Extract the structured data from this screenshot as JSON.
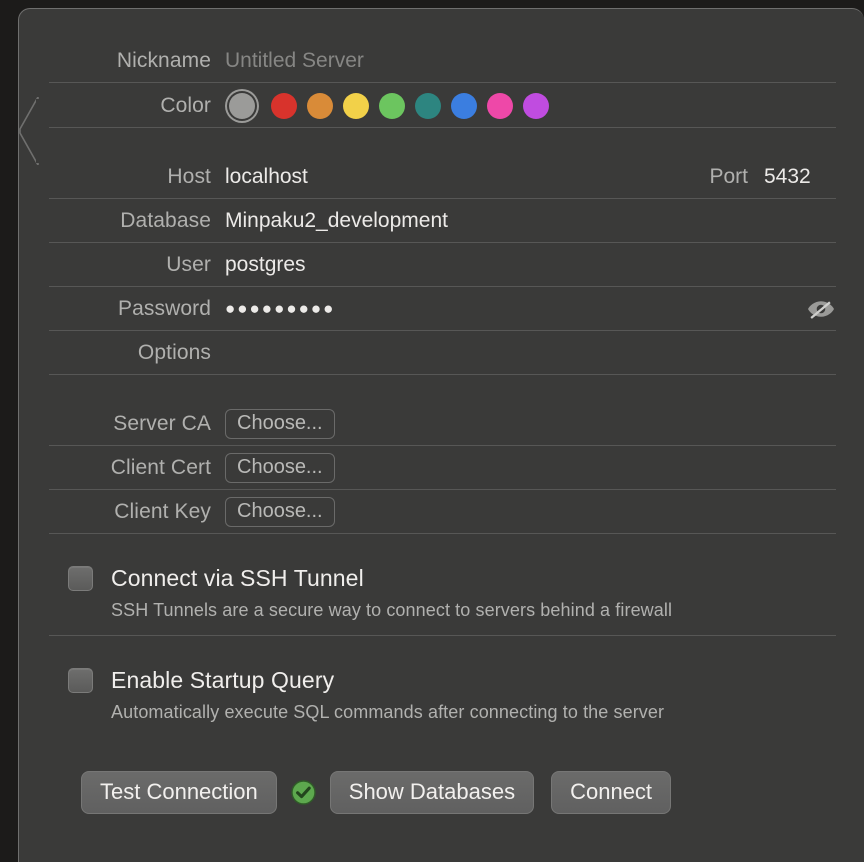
{
  "panel": {
    "accent_selected": "#9b9b99",
    "background": "#3a3a39"
  },
  "fields": {
    "nickname": {
      "label": "Nickname",
      "value": "",
      "placeholder": "Untitled Server"
    },
    "color": {
      "label": "Color",
      "selected_index": 0,
      "options": [
        {
          "name": "none",
          "hex": "#9b9b99"
        },
        {
          "name": "red",
          "hex": "#d8332c"
        },
        {
          "name": "orange",
          "hex": "#d98b38"
        },
        {
          "name": "yellow",
          "hex": "#f2d149"
        },
        {
          "name": "green",
          "hex": "#6cc55f"
        },
        {
          "name": "teal",
          "hex": "#2d8580"
        },
        {
          "name": "blue",
          "hex": "#3b7ee0"
        },
        {
          "name": "pink",
          "hex": "#ee48a8"
        },
        {
          "name": "purple",
          "hex": "#c04ce0"
        }
      ]
    },
    "host": {
      "label": "Host",
      "value": "localhost"
    },
    "port": {
      "label": "Port",
      "value": "5432"
    },
    "database": {
      "label": "Database",
      "value": "Minpaku2_development"
    },
    "user": {
      "label": "User",
      "value": "postgres"
    },
    "password": {
      "label": "Password",
      "value": "●●●●●●●●●",
      "visibility_icon": "eye-slash-icon"
    },
    "options": {
      "label": "Options",
      "value": ""
    },
    "server_ca": {
      "label": "Server CA",
      "button": "Choose..."
    },
    "client_cert": {
      "label": "Client Cert",
      "button": "Choose..."
    },
    "client_key": {
      "label": "Client Key",
      "button": "Choose..."
    }
  },
  "ssh_tunnel": {
    "title": "Connect via SSH Tunnel",
    "description": "SSH Tunnels are a secure way to connect to servers behind a firewall",
    "checked": false
  },
  "startup_query": {
    "title": "Enable Startup Query",
    "description": "Automatically execute SQL commands after connecting to the server",
    "checked": false
  },
  "footer": {
    "test_connection": "Test Connection",
    "status_icon": "check-circle-icon",
    "status_color": "#5da84e",
    "show_databases": "Show Databases",
    "connect": "Connect"
  }
}
